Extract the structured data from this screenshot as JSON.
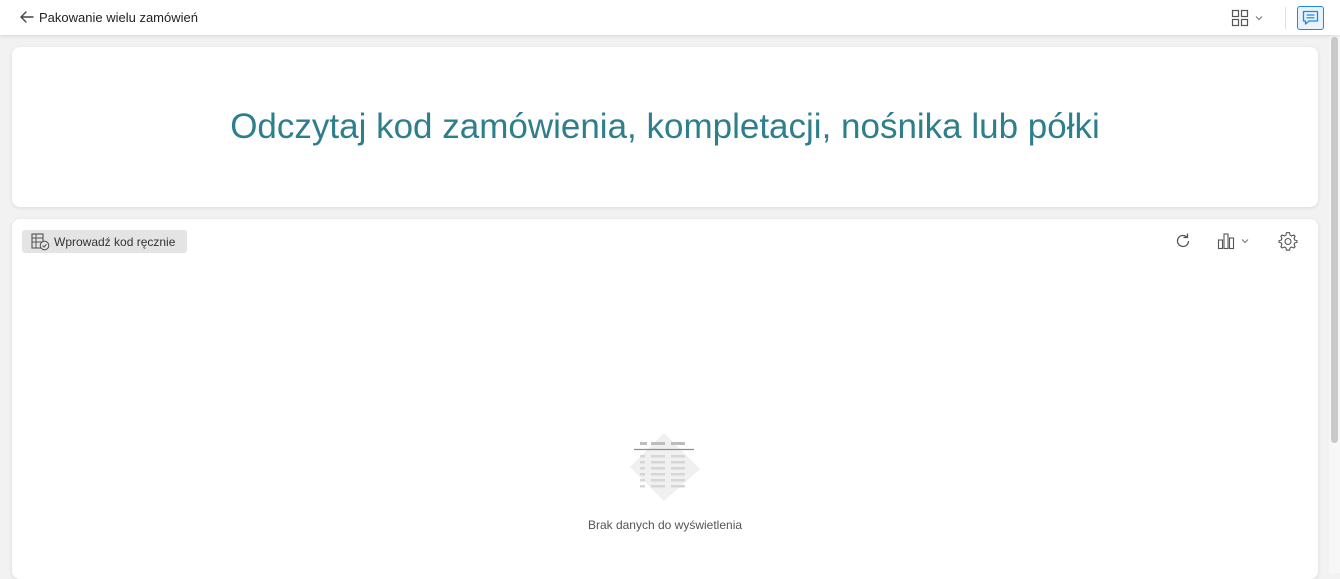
{
  "header": {
    "title": "Pakowanie wielu zamówień",
    "icons": {
      "back": "arrow-left-icon",
      "layout": "grid-layout-icon",
      "layout_dropdown": "chevron-down-icon",
      "chat": "chat-icon"
    },
    "chat_accent_color": "#1e88e5"
  },
  "scan_panel": {
    "prompt": "Odczytaj kod zamówienia, kompletacji, nośnika lub półki",
    "prompt_color": "#2e7f8c"
  },
  "main_panel": {
    "manual_button_label": "Wprowadź kod ręcznie",
    "toolbar_icons": [
      "refresh-icon",
      "bar-chart-icon",
      "settings-icon"
    ],
    "empty_state": {
      "icon": "empty-table-icon",
      "message": "Brak danych do wyświetlenia"
    }
  }
}
